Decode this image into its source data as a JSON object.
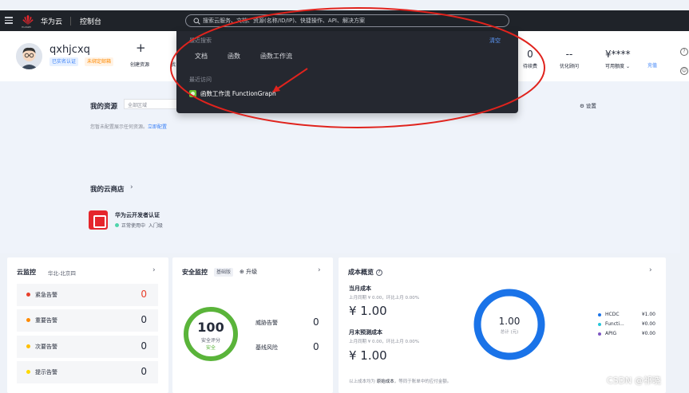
{
  "topbar": {
    "logo_text": "HUAWEI",
    "brand": "华为云",
    "console": "控制台",
    "search_placeholder": "搜索云服务、文档、资源(名称/ID/IP)、快捷操作、API、解决方案"
  },
  "search_dropdown": {
    "recent_search_title": "最近搜索",
    "clear_label": "清空",
    "recent_searches": [
      "文档",
      "函数",
      "函数工作流"
    ],
    "recent_visits_title": "最近访问",
    "recent_visits": [
      {
        "label": "函数工作流 FunctionGraph",
        "icon": "functiongraph-icon"
      }
    ]
  },
  "user": {
    "username": "qxhjcxq",
    "badge_verified": "已实名认证",
    "badge_email": "未绑定邮箱",
    "create_resource": "创建资源",
    "truncated_label": "我",
    "stats": [
      {
        "value": "0",
        "label": "待续费"
      },
      {
        "value": "--",
        "label": "优化顾问"
      },
      {
        "value": "¥****",
        "label": "可用额度"
      }
    ],
    "expand_label": "充值"
  },
  "resources": {
    "title": "我的资源",
    "region_placeholder": "全部区域",
    "settings_label": "设置",
    "empty_note": "您暂未配置展示任何资源。",
    "configure_link": "立即配置"
  },
  "store": {
    "title": "我的云商店",
    "item_name": "华为云开发者认证",
    "item_status": "正常使用中",
    "item_link": "入门级"
  },
  "cloud_monitor": {
    "title": "云监控",
    "region": "华北-北京四",
    "alarms": [
      {
        "label": "紧急告警",
        "count": "0",
        "color": "#e8402c"
      },
      {
        "label": "重要告警",
        "count": "0",
        "color": "#ff8a00"
      },
      {
        "label": "次要告警",
        "count": "0",
        "color": "#ffbf00"
      },
      {
        "label": "提示告警",
        "count": "0",
        "color": "#ffd900"
      }
    ]
  },
  "security": {
    "title": "安全监控",
    "edition_tag": "基础版",
    "upgrade_label": "升级",
    "score": "100",
    "score_label": "安全评分",
    "score_status": "安全",
    "risks": [
      {
        "label": "威胁告警",
        "value": "0"
      },
      {
        "label": "基线风险",
        "value": "0"
      }
    ]
  },
  "cost": {
    "title": "成本概览",
    "help_icon": "?",
    "current_label": "当月成本",
    "current_compare": "上月同期 ¥ 0.00，环比上月 0.00%",
    "current_amount": "¥ 1.00",
    "forecast_label": "月末预测成本",
    "forecast_compare": "上月同期 ¥ 0.00，环比上月 0.00%",
    "forecast_amount": "¥ 1.00",
    "donut_value": "1.00",
    "donut_label": "总计 (元)",
    "legend": [
      {
        "name": "HCDC",
        "amount": "¥1.00",
        "color": "#1a73e8"
      },
      {
        "name": "Functi...",
        "amount": "¥0.00",
        "color": "#26c6da"
      },
      {
        "name": "APIG",
        "amount": "¥0.00",
        "color": "#7e57c2"
      }
    ],
    "note_prefix": "以上成本均为",
    "note_link": "原始成本",
    "note_suffix": "，等同于账单中的应付金额。"
  },
  "watermark": "CSDN @祁晓"
}
